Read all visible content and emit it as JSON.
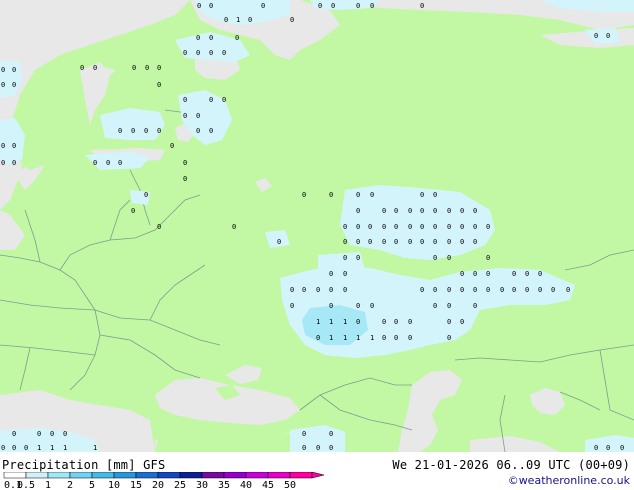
{
  "product": "Precipitation [mm]",
  "model": "GFS",
  "valid_time": "We 21-01-2026 06..09 UTC (00+09)",
  "credit": "©weatheronline.co.uk",
  "legend": {
    "labels": [
      "0.1",
      "0.5",
      "1",
      "2",
      "5",
      "10",
      "15",
      "20",
      "25",
      "30",
      "35",
      "40",
      "45",
      "50"
    ],
    "colors": [
      "#ffffff",
      "#d2f0fa",
      "#a0e6f5",
      "#6ed2f0",
      "#46b9e6",
      "#2896dc",
      "#1e6ed2",
      "#1446be",
      "#0a1e96",
      "#780aa0",
      "#9600c8",
      "#c800dc",
      "#e600c8",
      "#ff00a0"
    ]
  },
  "colors": {
    "land": "#c2f8a4",
    "sea": "#e8e8e8",
    "border": "#7f9c8c",
    "precip_light": "#d4f4fc",
    "precip_moderate": "#a6e8f6"
  },
  "grid_values": {
    "zero_glyph": "0",
    "one_glyph": "1"
  }
}
